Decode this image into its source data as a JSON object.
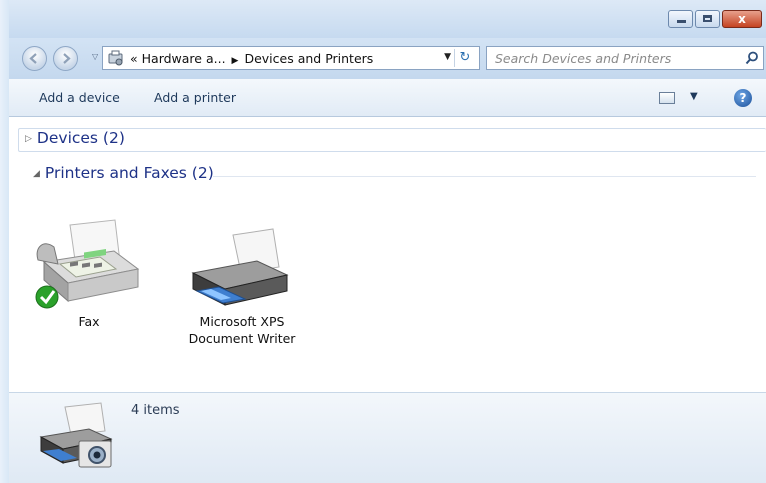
{
  "window": {
    "controls": {
      "minimize": "–",
      "maximize": "□",
      "close": "x"
    }
  },
  "address_bar": {
    "overflow": "«",
    "segments": [
      "Hardware a...",
      "Devices and Printers"
    ],
    "separator": "▶",
    "dropdown": "▼",
    "refresh": "↻"
  },
  "search": {
    "placeholder": "Search Devices and Printers"
  },
  "toolbar": {
    "add_device": "Add a device",
    "add_printer": "Add a printer",
    "view_dropdown": "▼",
    "help": "?"
  },
  "groups": [
    {
      "label": "Devices (2)",
      "expanded": false,
      "marker": "▷"
    },
    {
      "label": "Printers and Faxes (2)",
      "expanded": true,
      "marker": "◢",
      "items": [
        {
          "name": "Fax",
          "icon": "fax-icon",
          "default": true
        },
        {
          "name_line1": "Microsoft XPS",
          "name_line2": "Document Writer",
          "icon": "printer-icon"
        }
      ]
    }
  ],
  "details_pane": {
    "count": "4 items",
    "icon": "devices-and-printers-icon"
  },
  "colors": {
    "group_header": "#1e3287",
    "toolbar_text": "#1e395b",
    "accent_green": "#2aa12a"
  }
}
